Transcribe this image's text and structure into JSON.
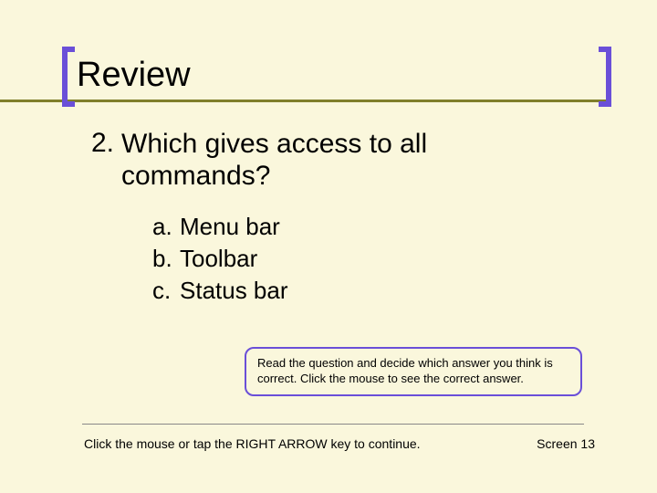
{
  "title": "Review",
  "question": {
    "number": "2.",
    "text": "Which gives access to all commands?",
    "options": [
      {
        "letter": "a.",
        "text": "Menu bar"
      },
      {
        "letter": "b.",
        "text": "Toolbar"
      },
      {
        "letter": "c.",
        "text": "Status bar"
      }
    ]
  },
  "hint": "Read the question and decide which answer you think is correct. Click the mouse to see the correct answer.",
  "footer": {
    "instruction": "Click the mouse or tap the RIGHT ARROW key to continue.",
    "screen": "Screen 13"
  }
}
